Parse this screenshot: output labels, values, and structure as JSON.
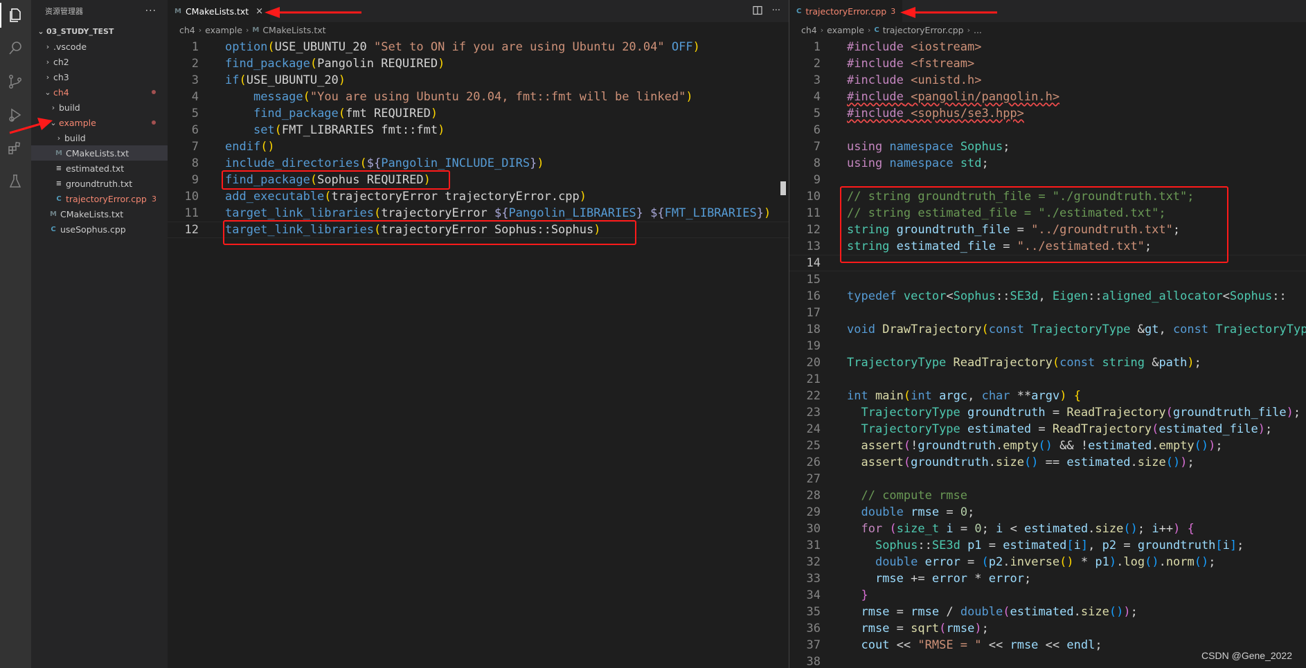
{
  "sidebar": {
    "title": "资源管理器",
    "more": "···",
    "project": "03_STUDY_TEST",
    "items": [
      {
        "label": ".vscode",
        "indent": 1,
        "kind": "folder",
        "expanded": false
      },
      {
        "label": "ch2",
        "indent": 1,
        "kind": "folder",
        "expanded": false
      },
      {
        "label": "ch3",
        "indent": 1,
        "kind": "folder",
        "expanded": false
      },
      {
        "label": "ch4",
        "indent": 1,
        "kind": "folder",
        "expanded": true,
        "red": true,
        "dot": true
      },
      {
        "label": "build",
        "indent": 2,
        "kind": "folder",
        "expanded": false
      },
      {
        "label": "example",
        "indent": 2,
        "kind": "folder",
        "expanded": true,
        "red": true,
        "dot": true
      },
      {
        "label": "build",
        "indent": 3,
        "kind": "folder",
        "expanded": false
      },
      {
        "label": "CMakeLists.txt",
        "indent": 3,
        "kind": "cmake",
        "selected": true
      },
      {
        "label": "estimated.txt",
        "indent": 3,
        "kind": "text"
      },
      {
        "label": "groundtruth.txt",
        "indent": 3,
        "kind": "text"
      },
      {
        "label": "trajectoryError.cpp",
        "indent": 3,
        "kind": "cpp",
        "red": true,
        "badge": "3"
      },
      {
        "label": "CMakeLists.txt",
        "indent": 2,
        "kind": "cmake"
      },
      {
        "label": "useSophus.cpp",
        "indent": 2,
        "kind": "cpp"
      }
    ]
  },
  "left_editor": {
    "tab": {
      "label": "CMakeLists.txt",
      "icon": "M",
      "close": "×"
    },
    "breadcrumb": [
      "ch4",
      "example",
      "CMakeLists.txt"
    ],
    "current_line": 12
  },
  "right_editor": {
    "tab": {
      "label": "trajectoryError.cpp",
      "icon": "C",
      "badge": "3"
    },
    "breadcrumb": [
      "ch4",
      "example",
      "trajectoryError.cpp",
      "..."
    ],
    "current_line": 14
  },
  "icons": {
    "explorer": "files-icon",
    "search": "search-icon",
    "scm": "source-control-icon",
    "debug": "run-debug-icon",
    "extensions": "extensions-icon",
    "testing": "flask-icon",
    "split": "split-editor-icon"
  },
  "colors": {
    "annotation": "#ff1a1a",
    "error_text": "#f48771"
  },
  "watermark": "CSDN @Gene_2022"
}
